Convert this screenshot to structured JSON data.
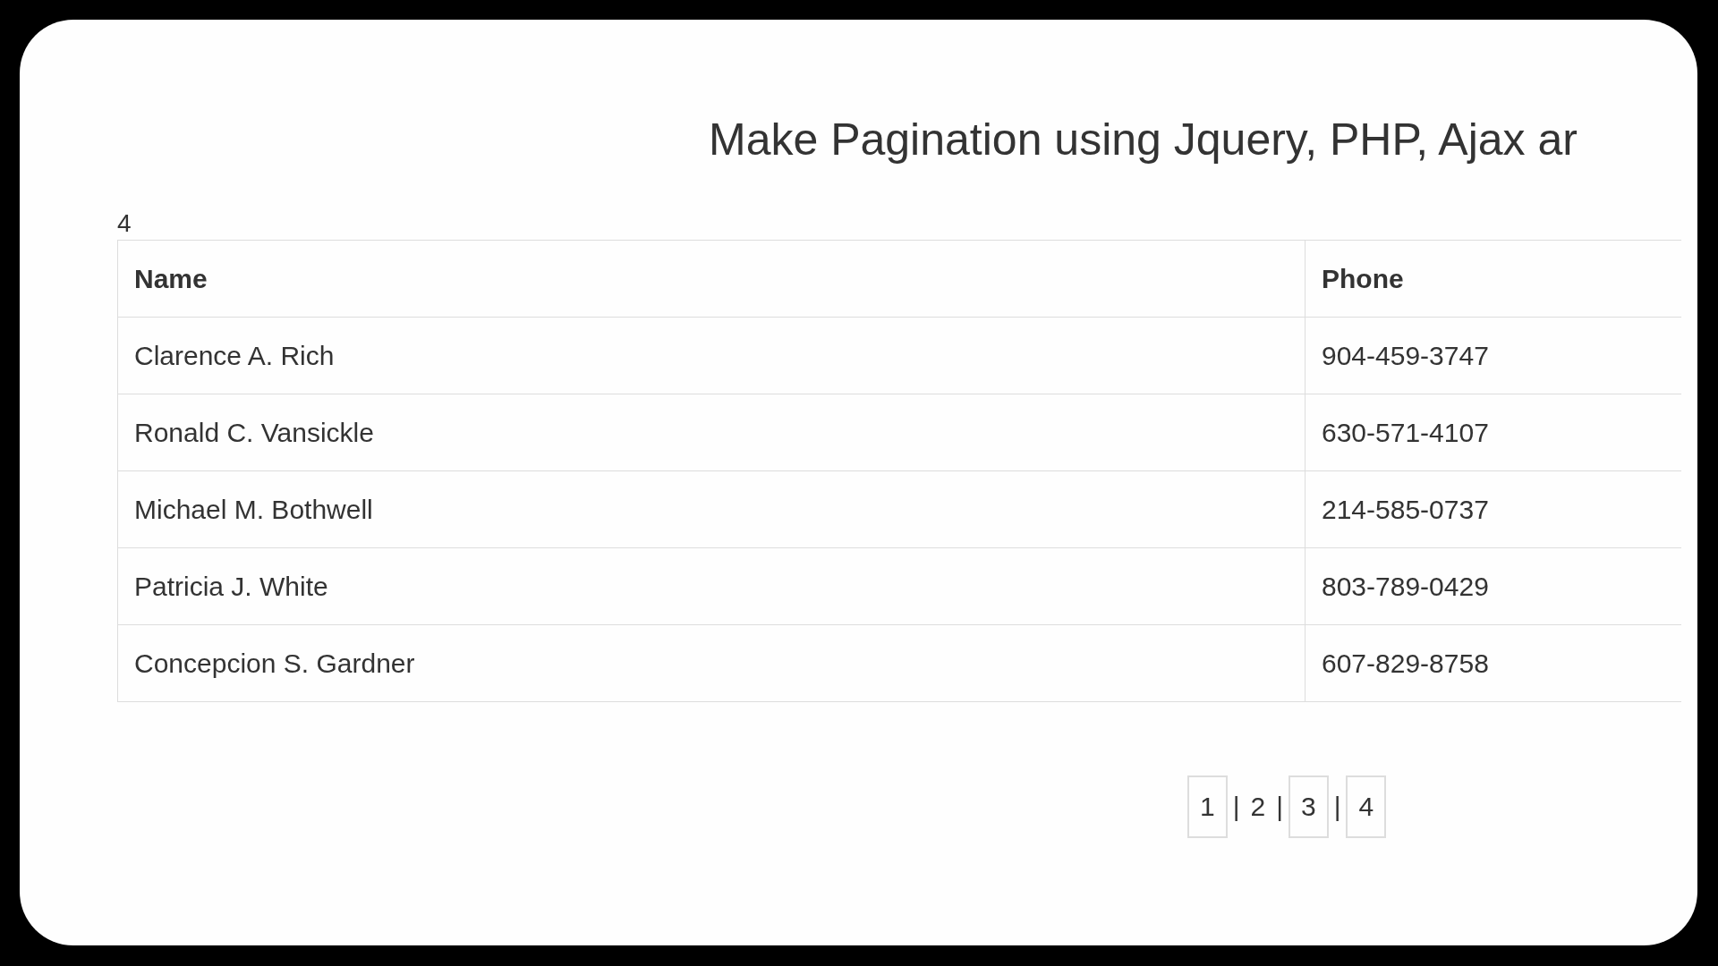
{
  "page": {
    "title": "Make Pagination using Jquery, PHP, Ajax ar",
    "page_count": "4"
  },
  "table": {
    "columns": [
      "Name",
      "Phone"
    ],
    "rows": [
      [
        "Clarence A. Rich",
        "904-459-3747"
      ],
      [
        "Ronald C. Vansickle",
        "630-571-4107"
      ],
      [
        "Michael M. Bothwell",
        "214-585-0737"
      ],
      [
        "Patricia J. White",
        "803-789-0429"
      ],
      [
        "Concepcion S. Gardner",
        "607-829-8758"
      ]
    ]
  },
  "pagination": [
    {
      "kind": "page",
      "label": "1",
      "selected": false
    },
    {
      "kind": "separator",
      "label": "|"
    },
    {
      "kind": "page",
      "label": "2",
      "selected": true
    },
    {
      "kind": "separator",
      "label": "|"
    },
    {
      "kind": "page",
      "label": "3",
      "selected": false
    },
    {
      "kind": "separator",
      "label": "|"
    },
    {
      "kind": "page",
      "label": "4",
      "selected": false
    }
  ]
}
